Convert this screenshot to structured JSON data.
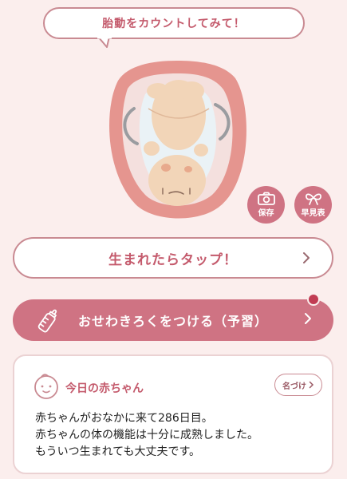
{
  "bubble": {
    "text": "胎動をカウントしてみて！"
  },
  "actions": {
    "camera_label": "保存",
    "early_label": "早見表"
  },
  "born_button": {
    "label": "生まれたらタップ！"
  },
  "record_button": {
    "label": "おせわきろくをつける（予習）"
  },
  "card": {
    "title": "今日の赤ちゃん",
    "name_button": "名づけ",
    "lines": [
      "赤ちゃんがおなかに来て286日目。",
      "赤ちゃんの体の機能は十分に成熟しました。",
      "もういつ生まれても大丈夫です。"
    ]
  },
  "colors": {
    "accent": "#cf7383",
    "accent_text": "#c45a6c",
    "background": "#fbeeed",
    "notification": "#c13c53"
  },
  "icons": [
    "bubble-tail",
    "fetus-illustration",
    "camera-icon",
    "ribbon-icon",
    "chevron-right-icon",
    "baby-bottle-icon",
    "baby-face-icon"
  ]
}
